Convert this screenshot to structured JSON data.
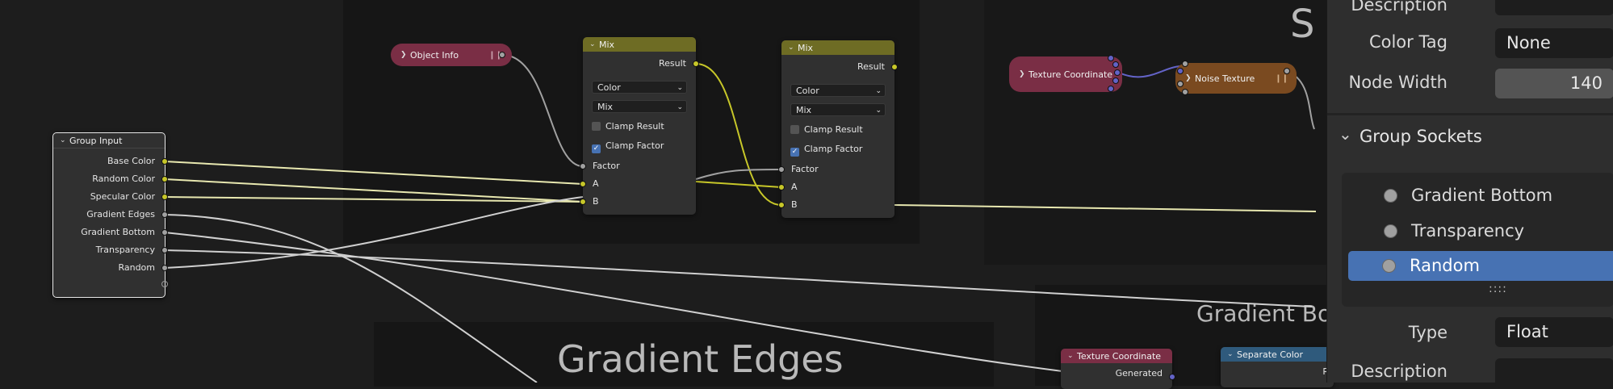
{
  "colors": {
    "mix_header": "#6e6c24",
    "object_info_pill": "#7a2e45",
    "texture_coordinate_pill": "#7a2e45",
    "noise_texture_pill": "#7a4a20",
    "separate_color_header": "#2f5a7c",
    "texture_coordinate_header": "#7a2e45",
    "selection_blue": "#4772b3",
    "socket_color": "#c7c729",
    "socket_float": "#a1a1a1",
    "socket_vector": "#6363c7"
  },
  "frames": {
    "top_right_partial_title": "S",
    "gradient_edges_title": "Gradient Edges",
    "gradient_bottom_partial_title": "Gradient Bo"
  },
  "nodes": {
    "object_info": {
      "label": "Object Info"
    },
    "mix1": {
      "title": "Mix",
      "output": "Result",
      "data_type": "Color",
      "blend_mode": "Mix",
      "clamp_result_label": "Clamp Result",
      "clamp_result": false,
      "clamp_factor_label": "Clamp Factor",
      "clamp_factor": true,
      "inputs": [
        "Factor",
        "A",
        "B"
      ]
    },
    "mix2": {
      "title": "Mix",
      "output": "Result",
      "data_type": "Color",
      "blend_mode": "Mix",
      "clamp_result_label": "Clamp Result",
      "clamp_result": false,
      "clamp_factor_label": "Clamp Factor",
      "clamp_factor": true,
      "inputs": [
        "Factor",
        "A",
        "B"
      ]
    },
    "group_input": {
      "title": "Group Input",
      "outputs": [
        "Base Color",
        "Random Color",
        "Specular Color",
        "Gradient Edges",
        "Gradient Bottom",
        "Transparency",
        "Random"
      ]
    },
    "texture_coordinate_collapsed": {
      "label": "Texture Coordinate"
    },
    "noise_texture": {
      "label": "Noise Texture"
    },
    "texture_coordinate": {
      "title": "Texture Coordinate",
      "output": "Generated"
    },
    "separate_color": {
      "title": "Separate Color",
      "output_partial": "R"
    }
  },
  "panel": {
    "description_label": "Description",
    "color_tag_label": "Color Tag",
    "color_tag_value": "None",
    "node_width_label": "Node Width",
    "node_width_value": "140",
    "group_sockets_title": "Group Sockets",
    "sockets": [
      {
        "label": "Gradient Bottom",
        "active": false
      },
      {
        "label": "Transparency",
        "active": false
      },
      {
        "label": "Random",
        "active": true
      }
    ],
    "drag_handle": "::::",
    "type_label": "Type",
    "type_value": "Float",
    "description2_label": "Description"
  }
}
